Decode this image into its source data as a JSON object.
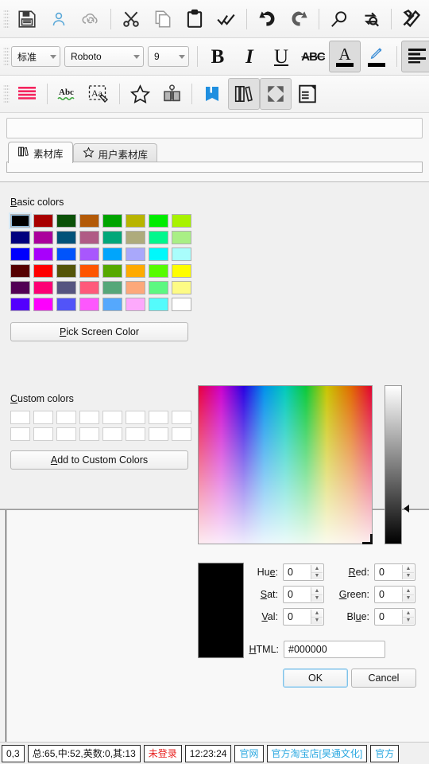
{
  "toolbar_main": {
    "buttons": [
      {
        "name": "save-button",
        "icon": "floppy-disk-icon",
        "title": "保存"
      },
      {
        "name": "account-button",
        "icon": "user-icon",
        "title": "账户"
      },
      {
        "name": "cloud-sync-button",
        "icon": "cloud-sync-icon",
        "title": "云同步"
      },
      {
        "name": "cut-button",
        "icon": "scissors-icon",
        "title": "剪切"
      },
      {
        "name": "copy-button",
        "icon": "copy-icon",
        "title": "复制"
      },
      {
        "name": "paste-button",
        "icon": "clipboard-icon",
        "title": "粘贴"
      },
      {
        "name": "check-all-button",
        "icon": "double-check-icon",
        "title": "校对"
      },
      {
        "name": "undo-button",
        "icon": "undo-arrow-icon",
        "title": "撤销"
      },
      {
        "name": "redo-button",
        "icon": "redo-arrow-icon",
        "title": "重做"
      },
      {
        "name": "find-button",
        "icon": "magnifier-icon",
        "title": "查找"
      },
      {
        "name": "replace-button",
        "icon": "find-replace-icon",
        "title": "替换"
      },
      {
        "name": "tools-button",
        "icon": "hammer-wrench-icon",
        "title": "工具"
      }
    ]
  },
  "toolbar_format": {
    "style_combo": {
      "value": "标准",
      "name": "paragraph-style-combo"
    },
    "font_combo": {
      "value": "Roboto",
      "name": "font-family-combo"
    },
    "size_combo": {
      "value": "9",
      "name": "font-size-combo"
    },
    "bold_label": "B",
    "italic_label": "I",
    "underline_label": "U",
    "strike_label": "ABC",
    "fontcolor_label": "A",
    "buttons": [
      {
        "name": "bold-button",
        "icon": "bold-icon"
      },
      {
        "name": "italic-button",
        "icon": "italic-icon"
      },
      {
        "name": "underline-button",
        "icon": "underline-icon"
      },
      {
        "name": "strikethrough-button",
        "icon": "strikethrough-icon"
      },
      {
        "name": "font-color-button",
        "icon": "font-color-icon"
      },
      {
        "name": "highlight-color-button",
        "icon": "pencil-highlight-icon"
      },
      {
        "name": "align-left-button",
        "icon": "align-left-icon"
      }
    ]
  },
  "toolbar_extra": {
    "buttons": [
      {
        "name": "line-spacing-button",
        "icon": "red-lines-icon"
      },
      {
        "name": "spellcheck-button",
        "icon": "abc-spellcheck-icon"
      },
      {
        "name": "text-effect-button",
        "icon": "aa-select-icon"
      },
      {
        "name": "favorite-button",
        "icon": "star-outline-icon"
      },
      {
        "name": "insert-symbol-button",
        "icon": "book-stand-icon"
      },
      {
        "name": "book-button",
        "icon": "blue-book-icon"
      },
      {
        "name": "material-library-button",
        "icon": "books-shelf-icon"
      },
      {
        "name": "fullscreen-button",
        "icon": "expand-arrows-icon"
      },
      {
        "name": "outline-button",
        "icon": "document-outline-icon"
      }
    ]
  },
  "panel": {
    "search_placeholder": "",
    "search_value": "",
    "tabs": [
      {
        "label": "素材库",
        "icon": "books-shelf-icon",
        "selected": true,
        "name": "tab-material-library"
      },
      {
        "label": "用户素材库",
        "icon": "star-outline-icon",
        "selected": false,
        "name": "tab-user-material-library"
      }
    ]
  },
  "color_dialog": {
    "basic_colors_label": "Basic colors",
    "basic_colors_accesskey": "B",
    "custom_colors_label": "Custom colors",
    "custom_colors_accesskey": "C",
    "pick_screen_color_label": "Pick Screen Color",
    "pick_screen_color_accesskey": "P",
    "add_to_custom_colors_label": "Add to Custom Colors",
    "add_to_custom_colors_accesskey": "A",
    "ok_label": "OK",
    "cancel_label": "Cancel",
    "basic_colors": [
      "#000000",
      "#a80000",
      "#0b5108",
      "#b35a07",
      "#00a400",
      "#b8b400",
      "#00ec00",
      "#a8f200",
      "#00007e",
      "#ab009c",
      "#005279",
      "#b05b85",
      "#00a779",
      "#aeab7c",
      "#00f78d",
      "#a9ef85",
      "#0000fd",
      "#a800fc",
      "#0054fb",
      "#a857fd",
      "#00a5fc",
      "#a9a8fb",
      "#00f8fb",
      "#a9fdfc",
      "#550000",
      "#fe0000",
      "#545408",
      "#fe5500",
      "#56a800",
      "#feaa00",
      "#56fb00",
      "#fefd00",
      "#510054",
      "#fd0075",
      "#555480",
      "#fe5a7b",
      "#55a779",
      "#fda87a",
      "#5cf881",
      "#fdfb85",
      "#5300fd",
      "#fd00fd",
      "#5254f8",
      "#fd57fd",
      "#55a8fd",
      "#fda9fc",
      "#54fbfc",
      "#ffffff"
    ],
    "custom_colors_count": 16,
    "selected_basic_index": 0,
    "preview_color": "#000000",
    "fields": [
      {
        "label": "Hue:",
        "accesskey": "e",
        "value": "0",
        "name": "hue-input"
      },
      {
        "label": "Sat:",
        "accesskey": "S",
        "value": "0",
        "name": "saturation-input"
      },
      {
        "label": "Val:",
        "accesskey": "V",
        "value": "0",
        "name": "value-input"
      }
    ],
    "rgb_fields": [
      {
        "label": "Red:",
        "accesskey": "R",
        "value": "0",
        "name": "red-input"
      },
      {
        "label": "Green:",
        "accesskey": "G",
        "value": "0",
        "name": "green-input"
      },
      {
        "label": "Blue:",
        "accesskey": "u",
        "value": "0",
        "name": "blue-input"
      }
    ],
    "html_label": "HTML:",
    "html_accesskey": "H",
    "html_value": "#000000"
  },
  "statusbar": {
    "cells": [
      {
        "text": "0,3",
        "name": "cursor-position-cell",
        "style": "plain"
      },
      {
        "text": "总:65,中:52,英数:0,其:13",
        "name": "word-count-cell",
        "style": "plain"
      },
      {
        "text": "未登录",
        "name": "login-status-cell",
        "style": "warn"
      },
      {
        "text": "12:23:24",
        "name": "clock-cell",
        "style": "plain"
      },
      {
        "text": "官网",
        "name": "official-site-link-cell",
        "style": "link"
      },
      {
        "text": "官方淘宝店[昊通文化]",
        "name": "taobao-shop-link-cell",
        "style": "link"
      },
      {
        "text": "官方",
        "name": "official-extra-link-cell",
        "style": "link"
      }
    ]
  }
}
